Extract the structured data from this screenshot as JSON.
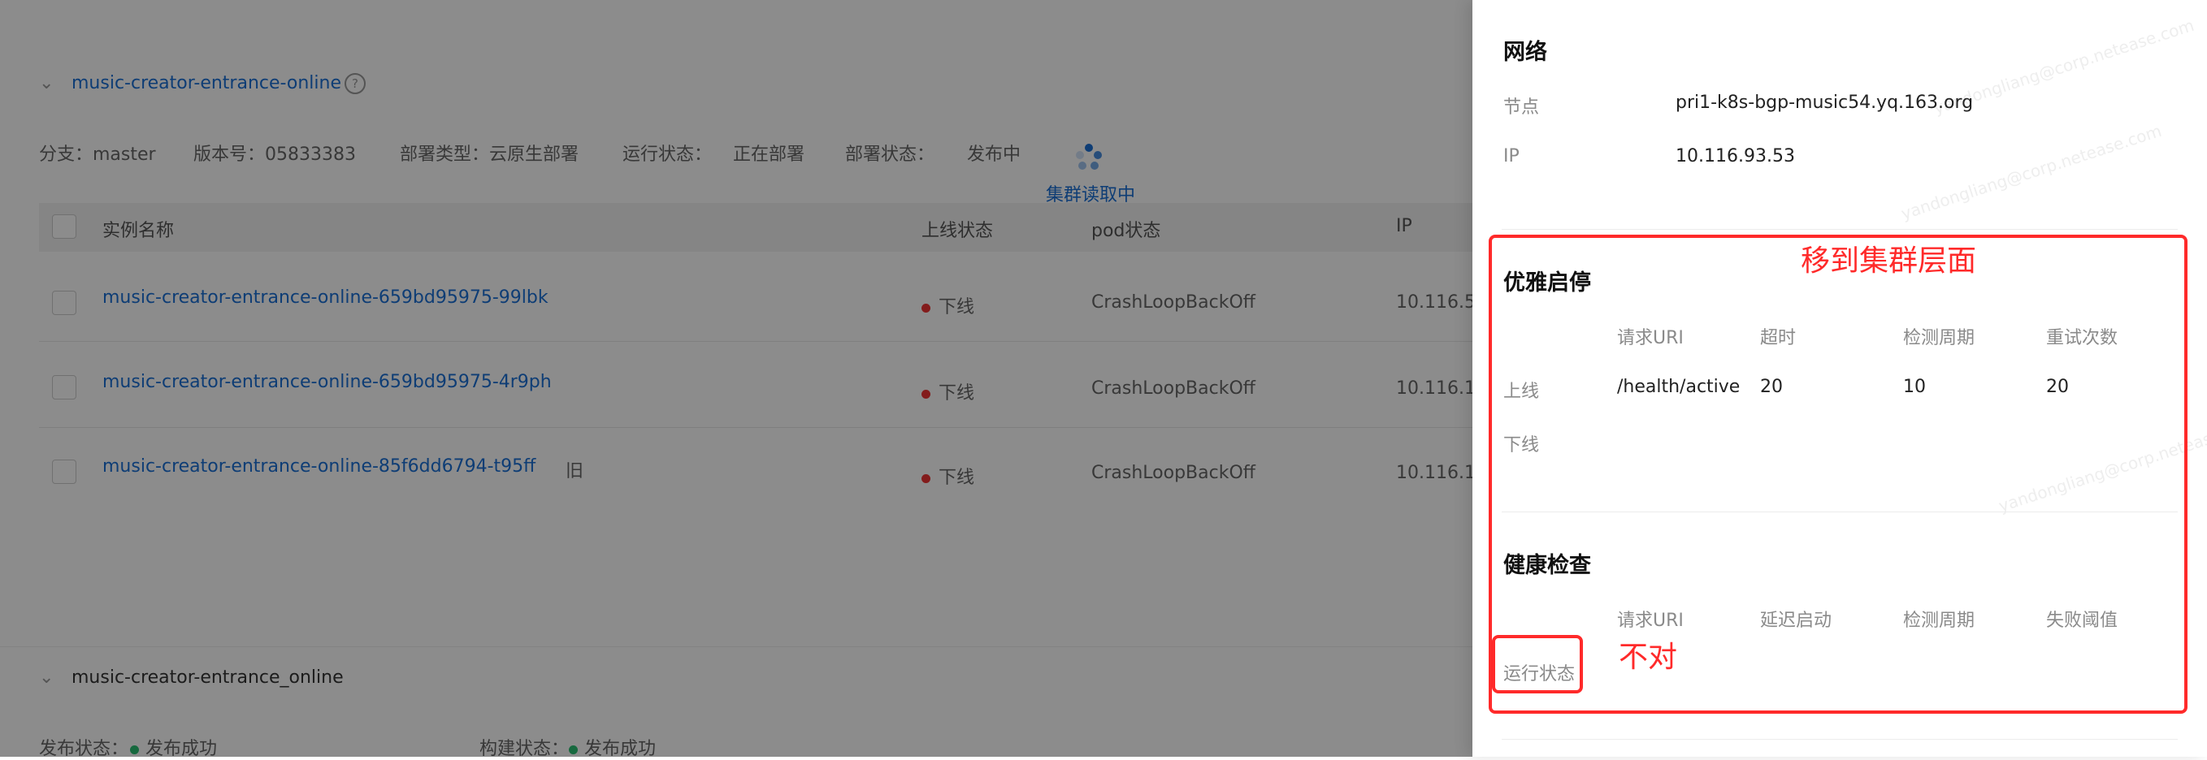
{
  "background": {
    "group1": {
      "title": "music-creator-entrance-online",
      "meta": {
        "branch": "分支：master",
        "version": "版本号：05833383",
        "deploy_type": "部署类型：云原生部署",
        "run_status": "运行状态：",
        "run_status_val": "正在部署",
        "deploy_status": "部署状态：",
        "deploy_status_val": "发布中"
      },
      "loading_text": "集群读取中",
      "columns": [
        "实例名称",
        "上线状态",
        "pod状态",
        "IP"
      ],
      "rows": [
        {
          "name": "music-creator-entrance-online-659bd95975-99lbk",
          "online": "下线",
          "pod": "CrashLoopBackOff",
          "ip": "10.116.5",
          "tag": ""
        },
        {
          "name": "music-creator-entrance-online-659bd95975-4r9ph",
          "online": "下线",
          "pod": "CrashLoopBackOff",
          "ip": "10.116.1",
          "tag": ""
        },
        {
          "name": "music-creator-entrance-online-85f6dd6794-t95ff",
          "online": "下线",
          "pod": "CrashLoopBackOff",
          "ip": "10.116.1",
          "tag": "旧"
        }
      ]
    },
    "group2": {
      "title": "music-creator-entrance_online",
      "publish_status": "发布状态：",
      "publish_status_val": "发布成功",
      "build_status": "构建状态：",
      "build_status_val": "发布成功"
    }
  },
  "drawer": {
    "network": {
      "heading": "网络",
      "node_label": "节点",
      "node_value": "pri1-k8s-bgp-music54.yq.163.org",
      "ip_label": "IP",
      "ip_value": "10.116.93.53"
    },
    "graceful": {
      "heading": "优雅启停",
      "columns": [
        "请求URI",
        "超时",
        "检测周期",
        "重试次数"
      ],
      "rows": [
        {
          "label": "上线",
          "uri": "/health/active",
          "timeout": "20",
          "period": "10",
          "retries": "20"
        },
        {
          "label": "下线",
          "uri": "",
          "timeout": "",
          "period": "",
          "retries": ""
        }
      ]
    },
    "health": {
      "heading": "健康检查",
      "columns": [
        "请求URI",
        "延迟启动",
        "检测周期",
        "失败阈值"
      ],
      "row_label": "运行状态"
    }
  },
  "annotations": {
    "move_to_cluster": "移到集群层面",
    "wrong": "不对",
    "color": "#ff2a2a"
  }
}
